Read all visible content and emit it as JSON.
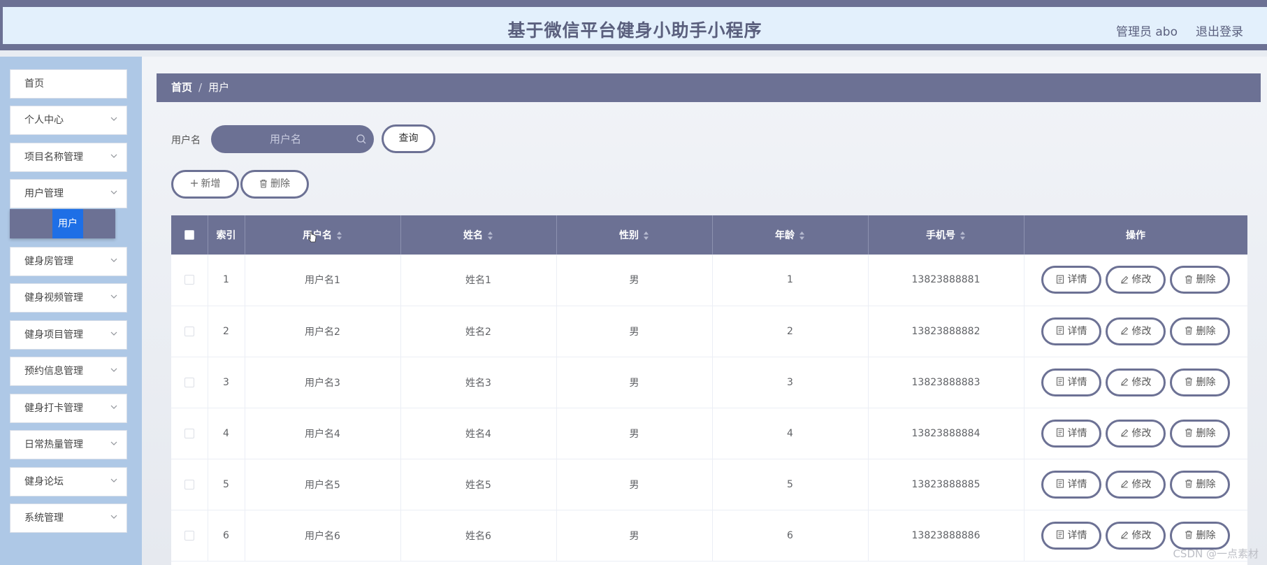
{
  "header": {
    "title": "基于微信平台健身小助手小程序",
    "admin": "管理员 abo",
    "logout": "退出登录"
  },
  "sidebar": {
    "items": [
      {
        "label": "首页",
        "has_chevron": false
      },
      {
        "label": "个人中心",
        "has_chevron": true
      },
      {
        "label": "项目名称管理",
        "has_chevron": true
      },
      {
        "label": "用户管理",
        "has_chevron": true
      },
      {
        "label": "健身房管理",
        "has_chevron": true
      },
      {
        "label": "健身视频管理",
        "has_chevron": true
      },
      {
        "label": "健身项目管理",
        "has_chevron": true
      },
      {
        "label": "预约信息管理",
        "has_chevron": true
      },
      {
        "label": "健身打卡管理",
        "has_chevron": true
      },
      {
        "label": "日常热量管理",
        "has_chevron": true
      },
      {
        "label": "健身论坛",
        "has_chevron": true
      },
      {
        "label": "系统管理",
        "has_chevron": true
      }
    ],
    "submenu_active": "用户"
  },
  "breadcrumb": {
    "home": "首页",
    "sep": "/",
    "current": "用户"
  },
  "search": {
    "label": "用户名",
    "placeholder": "用户名",
    "query_button": "查询"
  },
  "actions": {
    "add": "新增",
    "delete": "删除"
  },
  "table": {
    "columns": [
      "索引",
      "用户名",
      "姓名",
      "性别",
      "年龄",
      "手机号",
      "操作"
    ],
    "rows": [
      {
        "index": "1",
        "username": "用户名1",
        "name": "姓名1",
        "gender": "男",
        "age": "1",
        "phone": "13823888881"
      },
      {
        "index": "2",
        "username": "用户名2",
        "name": "姓名2",
        "gender": "男",
        "age": "2",
        "phone": "13823888882"
      },
      {
        "index": "3",
        "username": "用户名3",
        "name": "姓名3",
        "gender": "男",
        "age": "3",
        "phone": "13823888883"
      },
      {
        "index": "4",
        "username": "用户名4",
        "name": "姓名4",
        "gender": "男",
        "age": "4",
        "phone": "13823888884"
      },
      {
        "index": "5",
        "username": "用户名5",
        "name": "姓名5",
        "gender": "男",
        "age": "5",
        "phone": "13823888885"
      },
      {
        "index": "6",
        "username": "用户名6",
        "name": "姓名6",
        "gender": "男",
        "age": "6",
        "phone": "13823888886"
      }
    ],
    "row_actions": {
      "detail": "详情",
      "edit": "修改",
      "delete": "删除"
    }
  },
  "watermark": "CSDN @一点素材",
  "colors": {
    "primary": "#6c7194",
    "header_bg": "#e3f0fc",
    "sidebar_bg": "#aec8e6",
    "active_blue": "#1e6fe6"
  }
}
